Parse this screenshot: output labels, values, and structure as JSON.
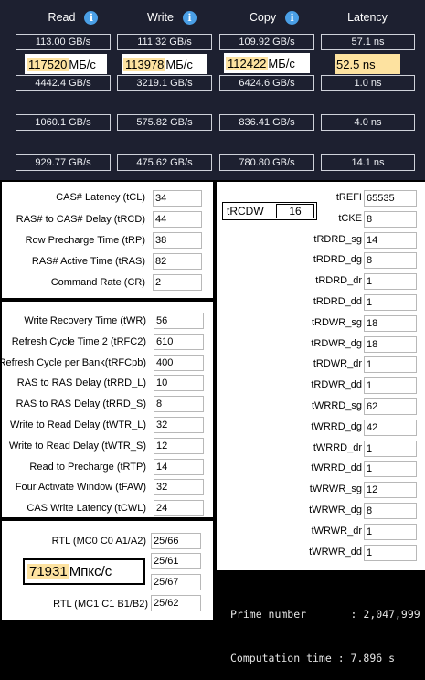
{
  "benchmark": {
    "headers": [
      {
        "label": "Read",
        "info": true
      },
      {
        "label": "Write",
        "info": true
      },
      {
        "label": "Copy",
        "info": true
      },
      {
        "label": "Latency",
        "info": false
      }
    ],
    "rows": [
      [
        "113.00 GB/s",
        "111.32 GB/s",
        "109.92 GB/s",
        "57.1 ns"
      ],
      [
        "4442.4 GB/s",
        "3219.1 GB/s",
        "6424.6 GB/s",
        "1.0 ns"
      ],
      [
        "1060.1 GB/s",
        "575.82 GB/s",
        "836.41 GB/s",
        "4.0 ns"
      ],
      [
        "929.77 GB/s",
        "475.62 GB/s",
        "780.80 GB/s",
        "14.1 ns"
      ]
    ],
    "overlays": {
      "read": {
        "value": "117520",
        "unit": " МБ/с"
      },
      "write": {
        "value": "113978",
        "unit": " МБ/с"
      },
      "copy": {
        "value": "112422",
        "unit": " МБ/с"
      },
      "latency": {
        "value": "52.5 ns",
        "unit": ""
      }
    },
    "info_glyph": "i"
  },
  "primary": [
    {
      "label": "CAS# Latency (tCL)",
      "value": "34"
    },
    {
      "label": "RAS# to CAS# Delay (tRCD)",
      "value": "44"
    },
    {
      "label": "Row Precharge Time (tRP)",
      "value": "38"
    },
    {
      "label": "RAS# Active Time (tRAS)",
      "value": "82"
    },
    {
      "label": "Command Rate (CR)",
      "value": "2"
    }
  ],
  "secondary": [
    {
      "label": "Write Recovery Time (tWR)",
      "value": "56"
    },
    {
      "label": "Refresh Cycle Time 2 (tRFC2)",
      "value": "610"
    },
    {
      "label": "Refresh Cycle per Bank(tRFCpb)",
      "value": "400"
    },
    {
      "label": "RAS to RAS Delay (tRRD_L)",
      "value": "10"
    },
    {
      "label": "RAS to RAS Delay (tRRD_S)",
      "value": "8"
    },
    {
      "label": "Write to Read Delay (tWTR_L)",
      "value": "32"
    },
    {
      "label": "Write to Read Delay (tWTR_S)",
      "value": "12"
    },
    {
      "label": "Read to Precharge (tRTP)",
      "value": "14"
    },
    {
      "label": "Four Activate Window (tFAW)",
      "value": "32"
    },
    {
      "label": "CAS Write Latency (tCWL)",
      "value": "24"
    }
  ],
  "rtl": {
    "row1": {
      "label": "RTL (MC0 C0 A1/A2)",
      "value": "25/66"
    },
    "row2": {
      "value": "25/61"
    },
    "row3": {
      "value": "25/67"
    },
    "row4": {
      "label": "RTL (MC1 C1 B1/B2)",
      "value": "25/62"
    },
    "overlay": {
      "value": "71931",
      "unit": " Мпкс/с"
    }
  },
  "trcdw": {
    "label": "tRCDW",
    "value": "16"
  },
  "right": [
    {
      "label": "tREFI",
      "value": "65535"
    },
    {
      "label": "tCKE",
      "value": "8"
    },
    {
      "label": "tRDRD_sg",
      "value": "14"
    },
    {
      "label": "tRDRD_dg",
      "value": "8"
    },
    {
      "label": "tRDRD_dr",
      "value": "1"
    },
    {
      "label": "tRDRD_dd",
      "value": "1"
    },
    {
      "label": "tRDWR_sg",
      "value": "18"
    },
    {
      "label": "tRDWR_dg",
      "value": "18"
    },
    {
      "label": "tRDWR_dr",
      "value": "1"
    },
    {
      "label": "tRDWR_dd",
      "value": "1"
    },
    {
      "label": "tWRRD_sg",
      "value": "62"
    },
    {
      "label": "tWRRD_dg",
      "value": "42"
    },
    {
      "label": "tWRRD_dr",
      "value": "1"
    },
    {
      "label": "tWRRD_dd",
      "value": "1"
    },
    {
      "label": "tWRWR_sg",
      "value": "12"
    },
    {
      "label": "tWRWR_dg",
      "value": "8"
    },
    {
      "label": "tWRWR_dr",
      "value": "1"
    },
    {
      "label": "tWRWR_dd",
      "value": "1"
    }
  ],
  "console": {
    "line1": "Prime number       : 2,047,999",
    "line2": "Computation time : 7.896 s"
  },
  "colors": {
    "bench_bg": "#1d2030",
    "highlight": "#fde2a0",
    "info_blue": "#4a9fe6"
  }
}
